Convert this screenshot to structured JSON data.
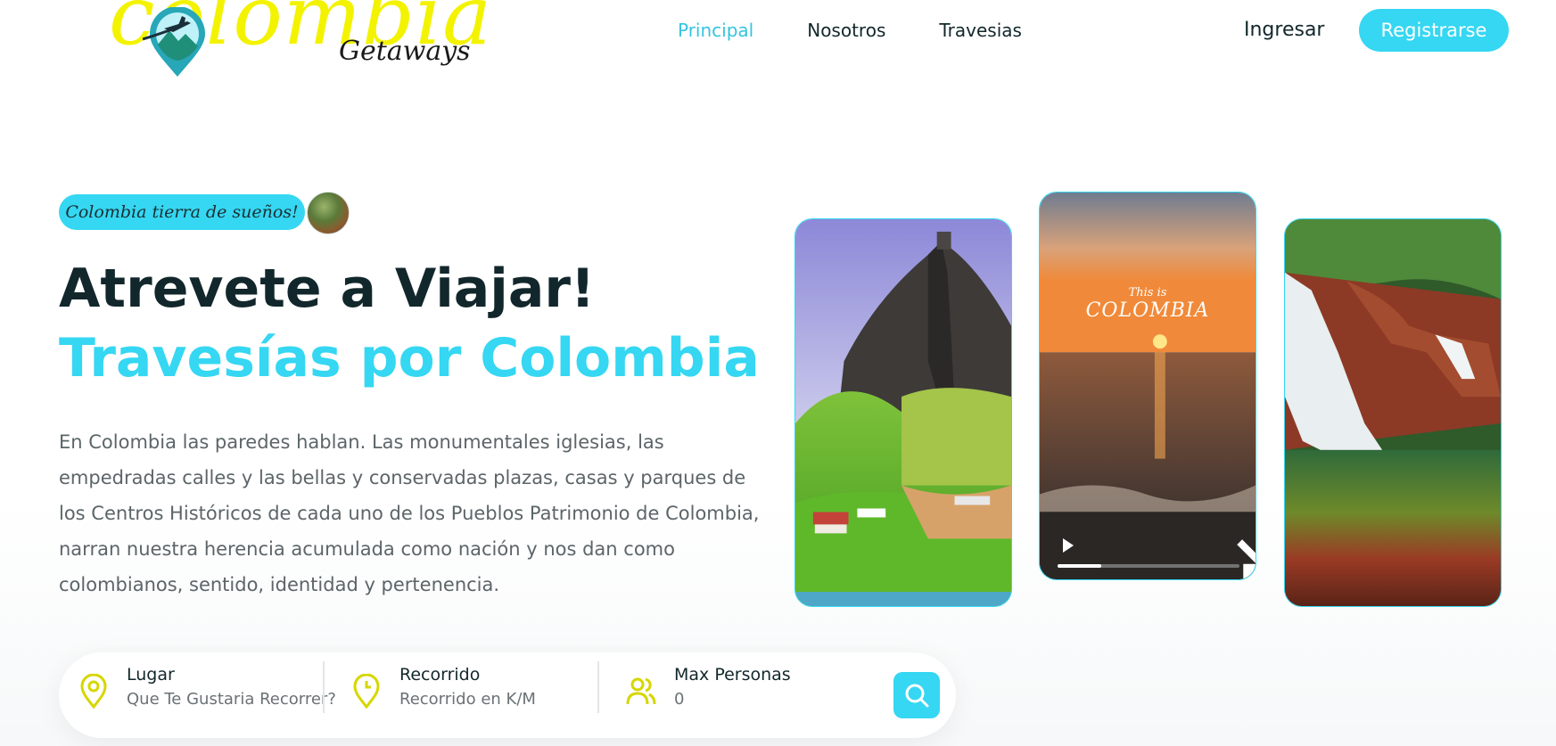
{
  "brand": {
    "logo_main": "colombia",
    "logo_sub": "Getaways",
    "logo_color": "#f3f300"
  },
  "nav": {
    "items": [
      {
        "label": "Principal",
        "active": true
      },
      {
        "label": "Nosotros",
        "active": false
      },
      {
        "label": "Travesias",
        "active": false
      }
    ]
  },
  "auth": {
    "login_label": "Ingresar",
    "register_label": "Registrarse"
  },
  "hero": {
    "tag": "Colombia tierra de sueños!",
    "title_part1": "Atrevete a Viajar! ",
    "title_part2": "Travesías por Colombia",
    "description": "En Colombia las paredes hablan. Las monumentales iglesias, las empedradas calles y las bellas y conservadas plazas, casas y parques de los Centros Históricos de cada uno de los Pueblos Patrimonio de Colombia, narran nuestra herencia acumulada como nación y nos dan como colombianos, sentido, identidad y pertenencia."
  },
  "gallery": {
    "video": {
      "overlay_small": "This is",
      "overlay_big": "COLOMBIA",
      "progress": 0.24
    }
  },
  "search": {
    "fields": [
      {
        "label": "Lugar",
        "value": "Que Te Gustaria Recorrer?",
        "icon": "map-pin-icon"
      },
      {
        "label": "Recorrido",
        "value": "Recorrido en K/M",
        "icon": "clock-icon"
      },
      {
        "label": "Max Personas",
        "value": "0",
        "icon": "users-icon"
      }
    ],
    "button_icon": "search-icon"
  },
  "colors": {
    "accent": "#35d7f2",
    "active_nav": "#35c4e0",
    "field_icon": "#d6d600",
    "heading": "#12272b"
  }
}
